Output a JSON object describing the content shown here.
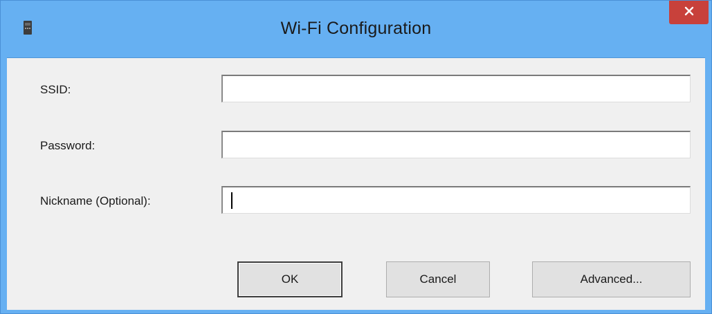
{
  "window": {
    "title": "Wi-Fi Configuration",
    "icon": "router-icon",
    "close_icon": "close-icon"
  },
  "form": {
    "ssid_label": "SSID:",
    "ssid_value": "",
    "password_label": "Password:",
    "password_value": "",
    "nickname_label": "Nickname (Optional):",
    "nickname_value": ""
  },
  "buttons": {
    "ok_label": "OK",
    "cancel_label": "Cancel",
    "advanced_label": "Advanced..."
  },
  "colors": {
    "titlebar": "#66b0f2",
    "close_button": "#c8413b",
    "dialog_background": "#f0f0f0"
  }
}
